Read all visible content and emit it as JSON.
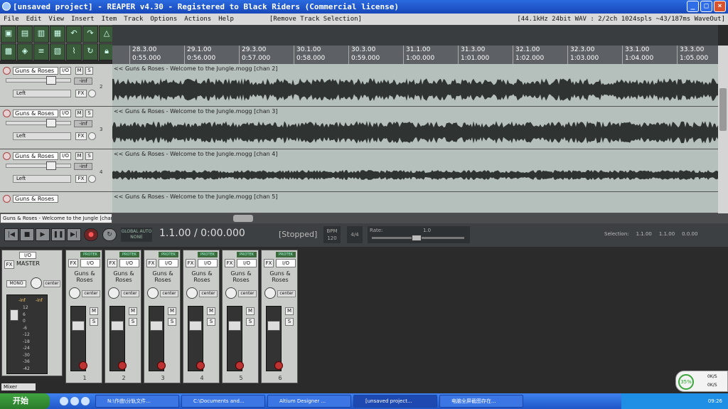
{
  "window": {
    "title": "[unsaved project] - REAPER v4.30 - Registered to Black Riders (Commercial license)",
    "btn_min": "_",
    "btn_max": "□",
    "btn_close": "×"
  },
  "menu": {
    "file": "File",
    "edit": "Edit",
    "view": "View",
    "insert": "Insert",
    "item": "Item",
    "track": "Track",
    "options": "Options",
    "actions": "Actions",
    "help": "Help",
    "last_action": "[Remove Track Selection]",
    "status": "[44.1kHz 24bit WAV : 2/2ch 1024spls ~43/187ms WaveOut]"
  },
  "ruler": {
    "ticks": [
      {
        "bar": "28.3.00",
        "time": "0:55.000"
      },
      {
        "bar": "29.1.00",
        "time": "0:56.000"
      },
      {
        "bar": "29.3.00",
        "time": "0:57.000"
      },
      {
        "bar": "30.1.00",
        "time": "0:58.000"
      },
      {
        "bar": "30.3.00",
        "time": "0:59.000"
      },
      {
        "bar": "31.1.00",
        "time": "1:00.000"
      },
      {
        "bar": "31.3.00",
        "time": "1:01.000"
      },
      {
        "bar": "32.1.00",
        "time": "1:02.000"
      },
      {
        "bar": "32.3.00",
        "time": "1:03.000"
      },
      {
        "bar": "33.1.00",
        "time": "1:04.000"
      },
      {
        "bar": "33.3.00",
        "time": "1:05.000"
      }
    ]
  },
  "tracks": [
    {
      "name": "Guns & Roses",
      "io": "I/O",
      "m": "M",
      "s": "S",
      "vol": "-inf",
      "pan": "Left",
      "fx": "FX",
      "num": "2",
      "item": "<< Guns & Roses - Welcome to the Jungle.mogg [chan 2]"
    },
    {
      "name": "Guns & Roses",
      "io": "I/O",
      "m": "M",
      "s": "S",
      "vol": "-inf",
      "pan": "Left",
      "fx": "FX",
      "num": "3",
      "item": "<< Guns & Roses - Welcome to the Jungle.mogg [chan 3]"
    },
    {
      "name": "Guns & Roses",
      "io": "I/O",
      "m": "M",
      "s": "S",
      "vol": "-inf",
      "pan": "Left",
      "fx": "FX",
      "num": "4",
      "item": "<< Guns & Roses - Welcome to the Jungle.mogg [chan 4]"
    }
  ],
  "partial_track": {
    "name": "Guns & Roses",
    "item": "<< Guns & Roses - Welcome to the Jungle.mogg [chan 5]"
  },
  "tooltip": "Guns & Roses - Welcome to the Jungle [chan",
  "transport": {
    "global_auto": "GLOBAL AUTO",
    "global_auto_mode": "NONE",
    "position": "1.1.00 / 0:00.000",
    "state": "[Stopped]",
    "bpm_label": "BPM",
    "bpm": "120",
    "timesig": "4/4",
    "rate_label": "Rate:",
    "rate": "1.0",
    "selection_label": "Selection:",
    "sel_start": "1.1.00",
    "sel_end": "1.1.00",
    "sel_len": "0.0.00"
  },
  "master": {
    "label": "MASTER",
    "io": "I/O",
    "fx": "FX",
    "mono": "MONO",
    "pan": "center",
    "inf_left": "-inf",
    "inf_right": "-inf",
    "scale": [
      "12",
      "6",
      "0",
      "-6",
      "-12",
      "-18",
      "-24",
      "-30",
      "-36",
      "-42"
    ]
  },
  "mixer_strips": [
    {
      "name": "Guns & Roses",
      "fx": "FX",
      "io": "I/O",
      "proc": "PROTEK",
      "pan": "center",
      "m": "M",
      "s": "S",
      "num": "1"
    },
    {
      "name": "Guns & Roses",
      "fx": "FX",
      "io": "I/O",
      "proc": "PROTEK",
      "pan": "center",
      "m": "M",
      "s": "S",
      "num": "2"
    },
    {
      "name": "Guns & Roses",
      "fx": "FX",
      "io": "I/O",
      "proc": "PROTEK",
      "pan": "center",
      "m": "M",
      "s": "S",
      "num": "3"
    },
    {
      "name": "Guns & Roses",
      "fx": "FX",
      "io": "I/O",
      "proc": "PROTEK",
      "pan": "center",
      "m": "M",
      "s": "S",
      "num": "4"
    },
    {
      "name": "Guns & Roses",
      "fx": "FX",
      "io": "I/O",
      "proc": "PROTEK",
      "pan": "center",
      "m": "M",
      "s": "S",
      "num": "5"
    },
    {
      "name": "Guns & Roses",
      "fx": "FX",
      "io": "I/O",
      "proc": "PROTEK",
      "pan": "center",
      "m": "M",
      "s": "S",
      "num": "6"
    }
  ],
  "mixer_tab": "Mixer",
  "taskbar": {
    "start": "开始",
    "tasks": [
      "N:\\作曲\\分轨文件...",
      "C:\\Documents and...",
      "Altium Designer ...",
      "[unsaved project...",
      "电脑全屏截图存在..."
    ],
    "clock": "09:26"
  },
  "network": {
    "percent": "35%",
    "up": "0K/S",
    "down": "0K/S"
  }
}
